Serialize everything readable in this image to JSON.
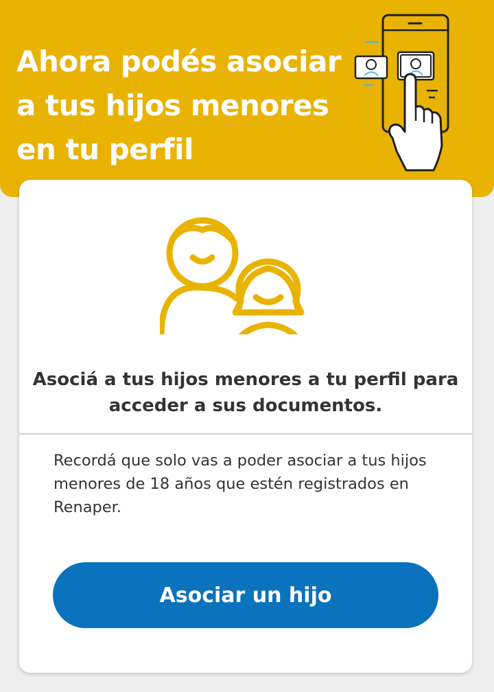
{
  "banner": {
    "title": "Ahora podés asociar a tus hijos menores en tu perfil",
    "background_color": "#e9b304",
    "illustration": "phone-hand-select-profile-icon"
  },
  "card": {
    "illustration": "children-icon",
    "heading": "Asociá a tus hijos menores a tu perfil para acceder a sus documentos.",
    "body": "Recordá que solo vas a poder asociar a tus hijos menores de 18 años que estén registrados en Renaper.",
    "button_label": "Asociar un hijo",
    "button_color": "#0b72bd",
    "accent_color": "#e9b304"
  }
}
